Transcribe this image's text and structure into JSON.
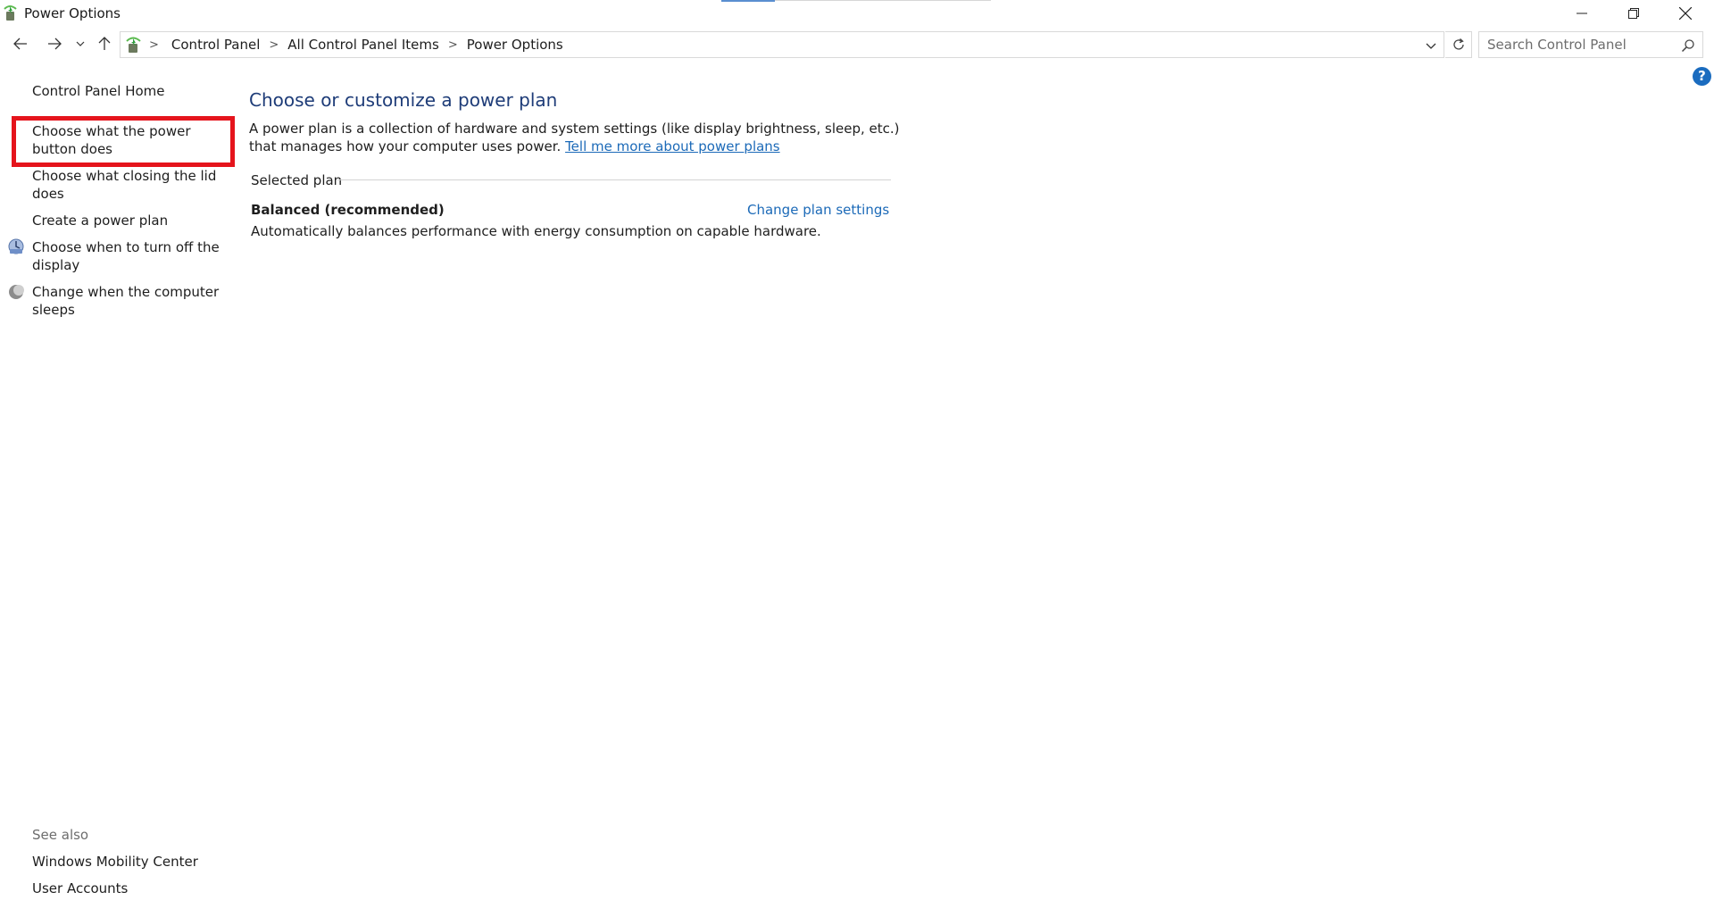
{
  "window": {
    "title": "Power Options",
    "controls": {
      "minimize": "minimize",
      "maximize": "restore",
      "close": "close"
    }
  },
  "address_bar": {
    "breadcrumbs": [
      "Control Panel",
      "All Control Panel Items",
      "Power Options"
    ],
    "search_placeholder": "Search Control Panel"
  },
  "sidebar": {
    "home": "Control Panel Home",
    "links": {
      "power_button": "Choose what the power button does",
      "closing_lid": "Choose what closing the lid does",
      "create_plan": "Create a power plan",
      "turn_off_display": "Choose when to turn off the display",
      "computer_sleeps": "Change when the computer sleeps"
    },
    "see_also": {
      "title": "See also",
      "links": [
        "Windows Mobility Center",
        "User Accounts"
      ]
    }
  },
  "main": {
    "title": "Choose or customize a power plan",
    "description": "A power plan is a collection of hardware and system settings (like display brightness, sleep, etc.) that manages how your computer uses power.",
    "description_link": "Tell me more about power plans",
    "selected_plan_label": "Selected plan",
    "plan": {
      "name": "Balanced (recommended)",
      "change_link": "Change plan settings",
      "description": "Automatically balances performance with energy consumption on capable hardware."
    }
  },
  "help": "?",
  "colors": {
    "highlight": "#e5141c",
    "link": "#1c6ab8",
    "title": "#1e3c78",
    "help": "#1b6cbf"
  }
}
